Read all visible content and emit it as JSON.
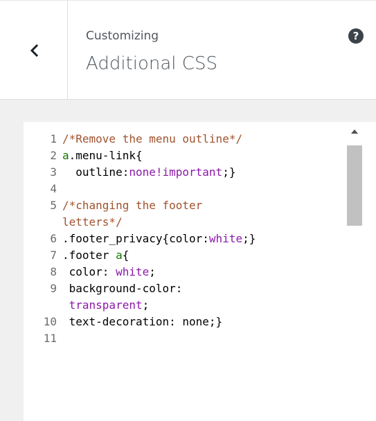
{
  "header": {
    "back_icon": "chevron-left-icon",
    "subtitle": "Customizing",
    "title": "Additional CSS",
    "help_icon_glyph": "?",
    "help_icon": "question-circle-icon"
  },
  "editor": {
    "lines": [
      {
        "num": "1",
        "segments": [
          {
            "t": "/*Remove the menu outline*/",
            "c": "comment"
          }
        ]
      },
      {
        "num": "2",
        "segments": [
          {
            "t": "a",
            "c": "tag"
          },
          {
            "t": ".menu-link{",
            "c": "plain"
          }
        ]
      },
      {
        "num": "3",
        "segments": [
          {
            "t": "  outline:",
            "c": "plain"
          },
          {
            "t": "none!important",
            "c": "atom"
          },
          {
            "t": ";}",
            "c": "plain"
          }
        ]
      },
      {
        "num": "4",
        "segments": []
      },
      {
        "num": "5",
        "segments": [
          {
            "t": "/*changing the footer",
            "c": "comment"
          }
        ]
      },
      {
        "num": "",
        "segments": [
          {
            "t": "letters*/",
            "c": "comment"
          }
        ]
      },
      {
        "num": "6",
        "segments": [
          {
            "t": ".footer_privacy{color:",
            "c": "plain"
          },
          {
            "t": "white",
            "c": "atom"
          },
          {
            "t": ";}",
            "c": "plain"
          }
        ]
      },
      {
        "num": "7",
        "segments": [
          {
            "t": ".footer ",
            "c": "plain"
          },
          {
            "t": "a",
            "c": "tag"
          },
          {
            "t": "{",
            "c": "plain"
          }
        ]
      },
      {
        "num": "8",
        "segments": [
          {
            "t": " color: ",
            "c": "plain"
          },
          {
            "t": "white",
            "c": "atom"
          },
          {
            "t": ";",
            "c": "plain"
          }
        ]
      },
      {
        "num": "9",
        "segments": [
          {
            "t": " background-color:",
            "c": "plain"
          }
        ]
      },
      {
        "num": "",
        "segments": [
          {
            "t": " transparent",
            "c": "atom"
          },
          {
            "t": ";",
            "c": "plain"
          }
        ]
      },
      {
        "num": "10",
        "segments": [
          {
            "t": " text-decoration: none;}",
            "c": "plain"
          }
        ]
      },
      {
        "num": "11",
        "segments": []
      }
    ],
    "colors": {
      "comment": "#a0522d",
      "tag": "#117700",
      "atom": "#8b19a6",
      "plain": "#000000"
    }
  }
}
